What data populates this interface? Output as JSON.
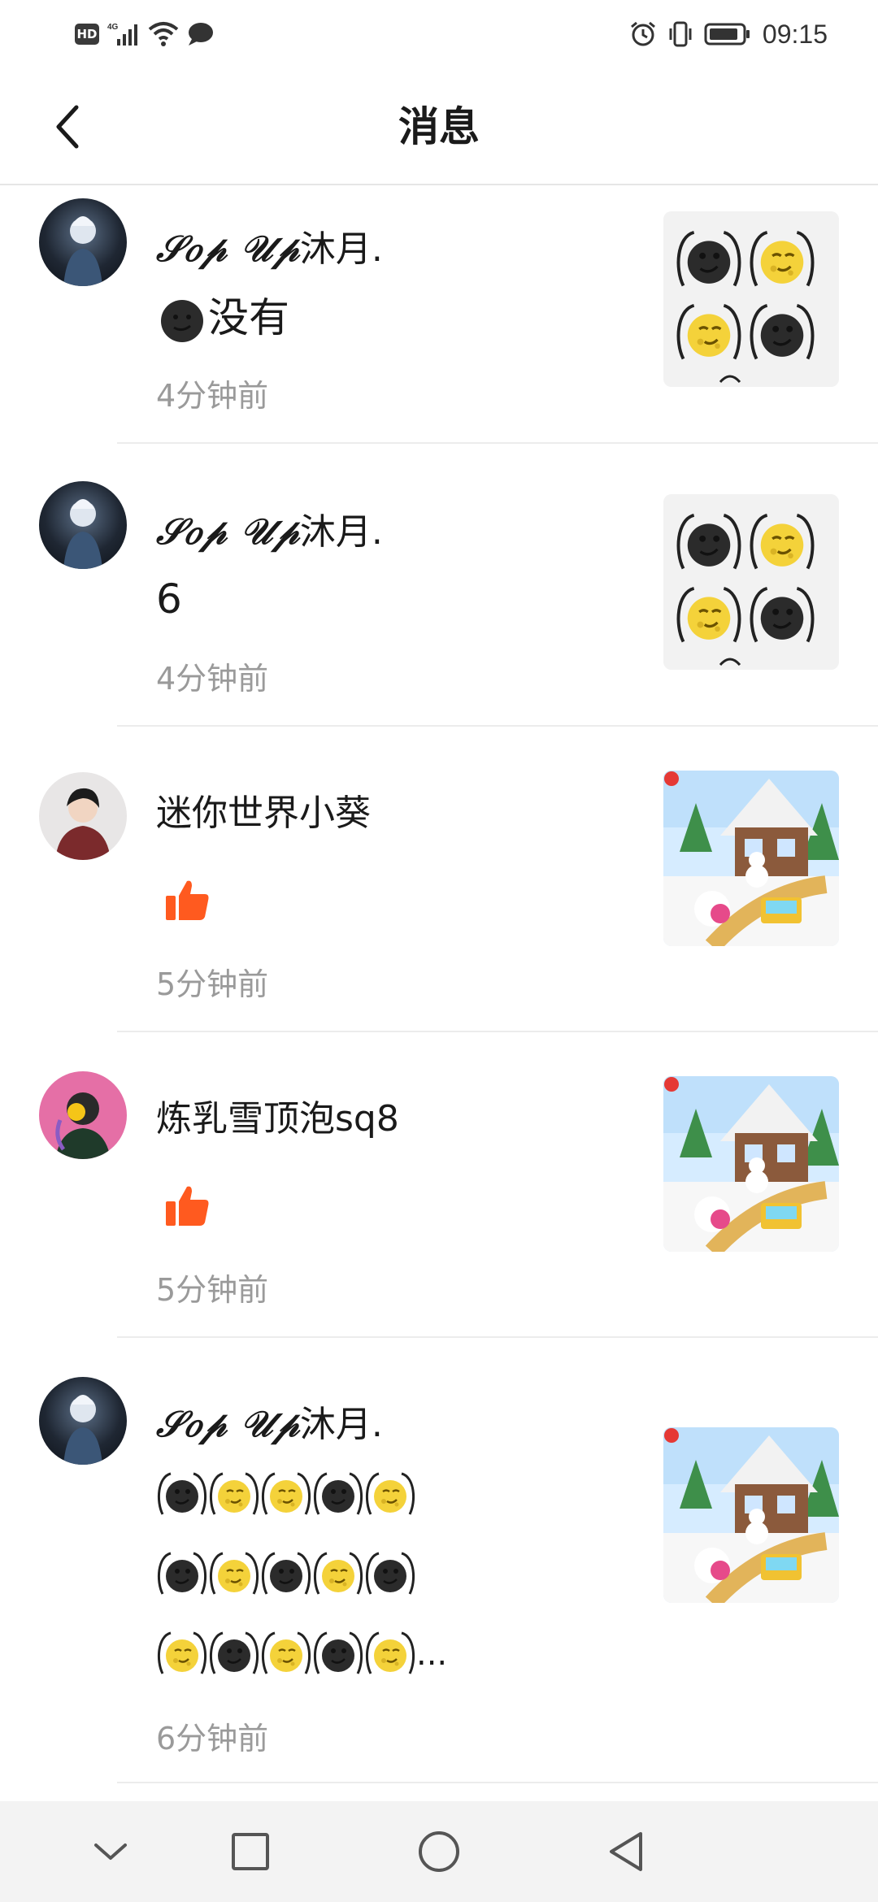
{
  "status_bar": {
    "left_icons": [
      "hd-icon",
      "4g-signal-icon",
      "wifi-icon",
      "message-icon"
    ],
    "hd_label": "HD",
    "right_icons": [
      "alarm-icon",
      "vibrate-icon",
      "battery-icon"
    ],
    "time": "09:15"
  },
  "header": {
    "title": "消息",
    "back_icon": "chevron-left-icon"
  },
  "messages": [
    {
      "name_script": "𝒮𝑜𝓅 𝒰𝓅",
      "name_text": "沐月.",
      "body_text": "没有",
      "time": "4分钟前",
      "thumb": "emoji-sticker-thumbnail"
    },
    {
      "name_script": "𝒮𝑜𝓅 𝒰𝓅",
      "name_text": "沐月.",
      "body_text": "6",
      "time": "4分钟前",
      "thumb": "emoji-sticker-thumbnail"
    },
    {
      "name_text": "迷你世界小葵",
      "like_icon": "thumbs-up-icon",
      "time": "5分钟前",
      "thumb": "game-screenshot-thumbnail"
    },
    {
      "name_text": "炼乳雪顶泡sq8",
      "like_icon": "thumbs-up-icon",
      "time": "5分钟前",
      "thumb": "game-screenshot-thumbnail"
    },
    {
      "name_script": "𝒮𝑜𝓅 𝒰𝓅",
      "name_text": "沐月.",
      "body_ellipsis": "...",
      "time": "6分钟前",
      "thumb": "game-screenshot-thumbnail"
    }
  ],
  "nav_bar": {
    "buttons": [
      "chevron-down-icon",
      "square-recents-icon",
      "circle-home-icon",
      "triangle-back-icon"
    ]
  },
  "colors": {
    "like_orange": "#ff5a1f",
    "time_gray": "#9a9a9a",
    "divider": "#ececec"
  }
}
